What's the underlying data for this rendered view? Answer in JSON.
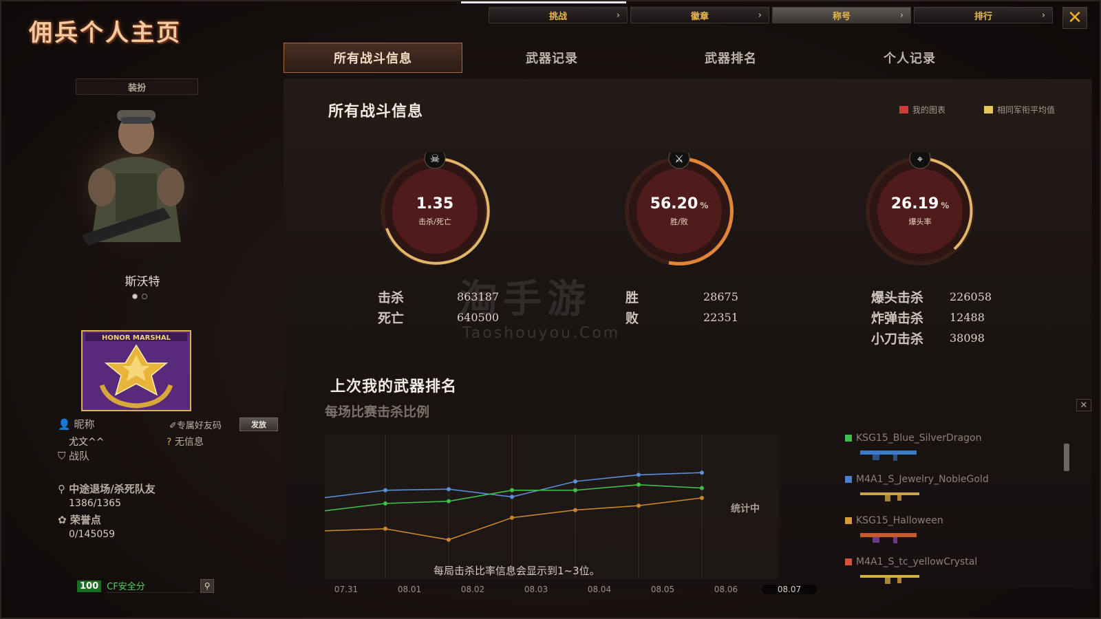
{
  "title": "佣兵个人主页",
  "top_nav": [
    {
      "label": "挑战",
      "active": false
    },
    {
      "label": "徽章",
      "active": false
    },
    {
      "label": "称号",
      "active": true
    },
    {
      "label": "排行",
      "active": false
    }
  ],
  "tabs": [
    "所有战斗信息",
    "武器记录",
    "武器排名",
    "个人记录"
  ],
  "left": {
    "dress_label": "装扮",
    "char_name": "斯沃特",
    "badge_text": "HONOR MARSHAL",
    "nickname_label": "昵称",
    "nickname_value": "尤文^^",
    "friend_code_label": "专属好友码",
    "send_label": "发放",
    "no_info": "无信息",
    "team_label": "战队",
    "quit_label": "中途退场/杀死队友",
    "quit_value": "1386/1365",
    "honor_label": "荣誉点",
    "honor_value": "0/145059",
    "safety_score": "100",
    "safety_label": "CF安全分"
  },
  "main": {
    "section_title": "所有战斗信息",
    "legend_mine": "我的图表",
    "legend_avg": "相同军衔平均值",
    "gauges": [
      {
        "value": "1.35",
        "unit": "",
        "label": "击杀/死亡"
      },
      {
        "value": "56.20",
        "unit": "%",
        "label": "胜/败"
      },
      {
        "value": "26.19",
        "unit": "%",
        "label": "爆头率"
      }
    ],
    "stats": {
      "kill_label": "击杀",
      "kill_value": "863187",
      "death_label": "死亡",
      "death_value": "640500",
      "win_label": "胜",
      "win_value": "28675",
      "lose_label": "败",
      "lose_value": "22351",
      "hs_label": "爆头击杀",
      "hs_value": "226058",
      "bomb_label": "炸弹击杀",
      "bomb_value": "12488",
      "knife_label": "小刀击杀",
      "knife_value": "38098"
    },
    "watermark": "淘手游",
    "watermark_url": "Taoshouyou.Com",
    "ranking_title": "上次我的武器排名",
    "ranking_sub": "每场比赛击杀比例",
    "stat_note": "统计中",
    "footer_note": "每局击杀比率信息会显示到1~3位。",
    "dates": [
      "07.31",
      "08.01",
      "08.02",
      "08.03",
      "08.04",
      "08.05",
      "08.06",
      "08.07"
    ],
    "selected_date": "08.07",
    "weapons": [
      {
        "name": "KSG15_Blue_SilverDragon",
        "color": "#3fbf4a"
      },
      {
        "name": "M4A1_S_Jewelry_NobleGold",
        "color": "#4a7fd0"
      },
      {
        "name": "KSG15_Halloween",
        "color": "#d89a38"
      },
      {
        "name": "M4A1_S_tc_yellowCrystal",
        "color": "#d0553a"
      }
    ]
  },
  "colors": {
    "accent_gold": "#e9b84c",
    "legend_mine": "#d23a3a",
    "legend_avg": "#e3c95a",
    "series_blue": "#5c8ed6",
    "series_green": "#3fbf4a",
    "series_orange": "#c9852e"
  },
  "chart_data": {
    "type": "line",
    "x": [
      "07.31",
      "08.01",
      "08.02",
      "08.03",
      "08.04",
      "08.05",
      "08.06"
    ],
    "series": [
      {
        "values": [
          0.55,
          0.62,
          0.63,
          0.56,
          0.7,
          0.76,
          0.78
        ]
      },
      {
        "values": [
          0.43,
          0.5,
          0.52,
          0.62,
          0.62,
          0.67,
          0.64
        ]
      },
      {
        "values": [
          0.25,
          0.27,
          0.17,
          0.37,
          0.44,
          0.48,
          0.55
        ]
      }
    ],
    "ylim": [
      0,
      1
    ]
  }
}
